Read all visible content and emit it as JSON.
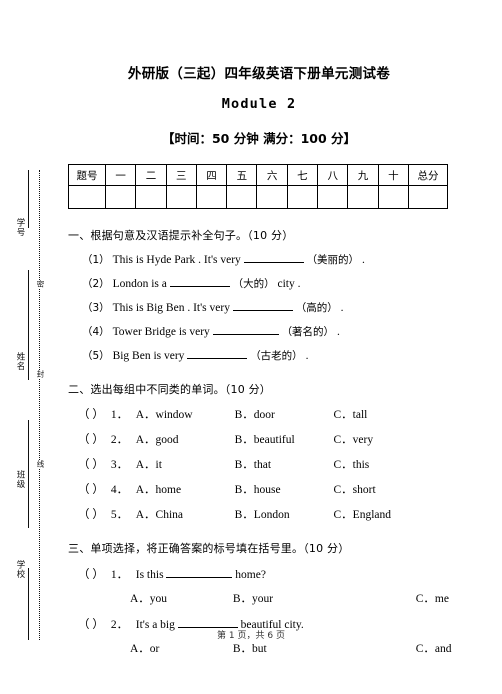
{
  "document": {
    "title": "外研版（三起）四年级英语下册单元测试卷",
    "subtitle": "Module 2",
    "meta": "【时间：50 分钟  满分：100 分】",
    "footer": "第 1 页，共 6 页"
  },
  "seal": {
    "labels": [
      "学号",
      "姓名",
      "班级",
      "学校"
    ],
    "line_chars": [
      "密",
      "封",
      "线"
    ]
  },
  "score_table": {
    "headers": [
      "题号",
      "一",
      "二",
      "三",
      "四",
      "五",
      "六",
      "七",
      "八",
      "九",
      "十",
      "总分"
    ],
    "values": [
      "",
      "",
      "",
      "",
      "",
      "",
      "",
      "",
      "",
      "",
      "",
      ""
    ]
  },
  "sections": [
    {
      "heading": "一、根据句意及汉语提示补全句子。（10 分）",
      "items": [
        {
          "num": "（1）",
          "pre": "This is Hyde Park . It's very",
          "hint": "（美丽的）",
          "post": "."
        },
        {
          "num": "（2）",
          "pre": "London is a",
          "hint": "（大的）",
          "post": "city ."
        },
        {
          "num": "（3）",
          "pre": "This is Big Ben . It's very",
          "hint": "（高的）",
          "post": "."
        },
        {
          "num": "（4）",
          "pre": "Tower Bridge is very",
          "hint": "（著名的）",
          "post": "."
        },
        {
          "num": "（5）",
          "pre": "Big Ben is very",
          "hint": "（古老的）",
          "post": "."
        }
      ]
    },
    {
      "heading": "二、选出每组中不同类的单词。（10 分）",
      "items": [
        {
          "paren": "（    ）",
          "num": "1．",
          "a": "A．window",
          "b": "B．door",
          "c": "C．tall"
        },
        {
          "paren": "（    ）",
          "num": "2．",
          "a": "A．good",
          "b": "B．beautiful",
          "c": "C．very"
        },
        {
          "paren": "（    ）",
          "num": "3．",
          "a": "A．it",
          "b": "B．that",
          "c": "C．this"
        },
        {
          "paren": "（    ）",
          "num": "4．",
          "a": "A．home",
          "b": "B．house",
          "c": "C．short"
        },
        {
          "paren": "（    ）",
          "num": "5．",
          "a": "A．China",
          "b": "B．London",
          "c": "C．England"
        }
      ]
    },
    {
      "heading": "三、单项选择，将正确答案的标号填在括号里。（10 分）",
      "questions": [
        {
          "paren": "（    ）",
          "num": "1．",
          "stem_pre": "Is this",
          "stem_post": "home?",
          "a": "A．you",
          "b": "B．your",
          "c": "C．me"
        },
        {
          "paren": "（    ）",
          "num": "2．",
          "stem_pre": "It's a big",
          "stem_post": "beautiful city.",
          "a": "A．or",
          "b": "B．but",
          "c": "C．and"
        }
      ]
    }
  ]
}
